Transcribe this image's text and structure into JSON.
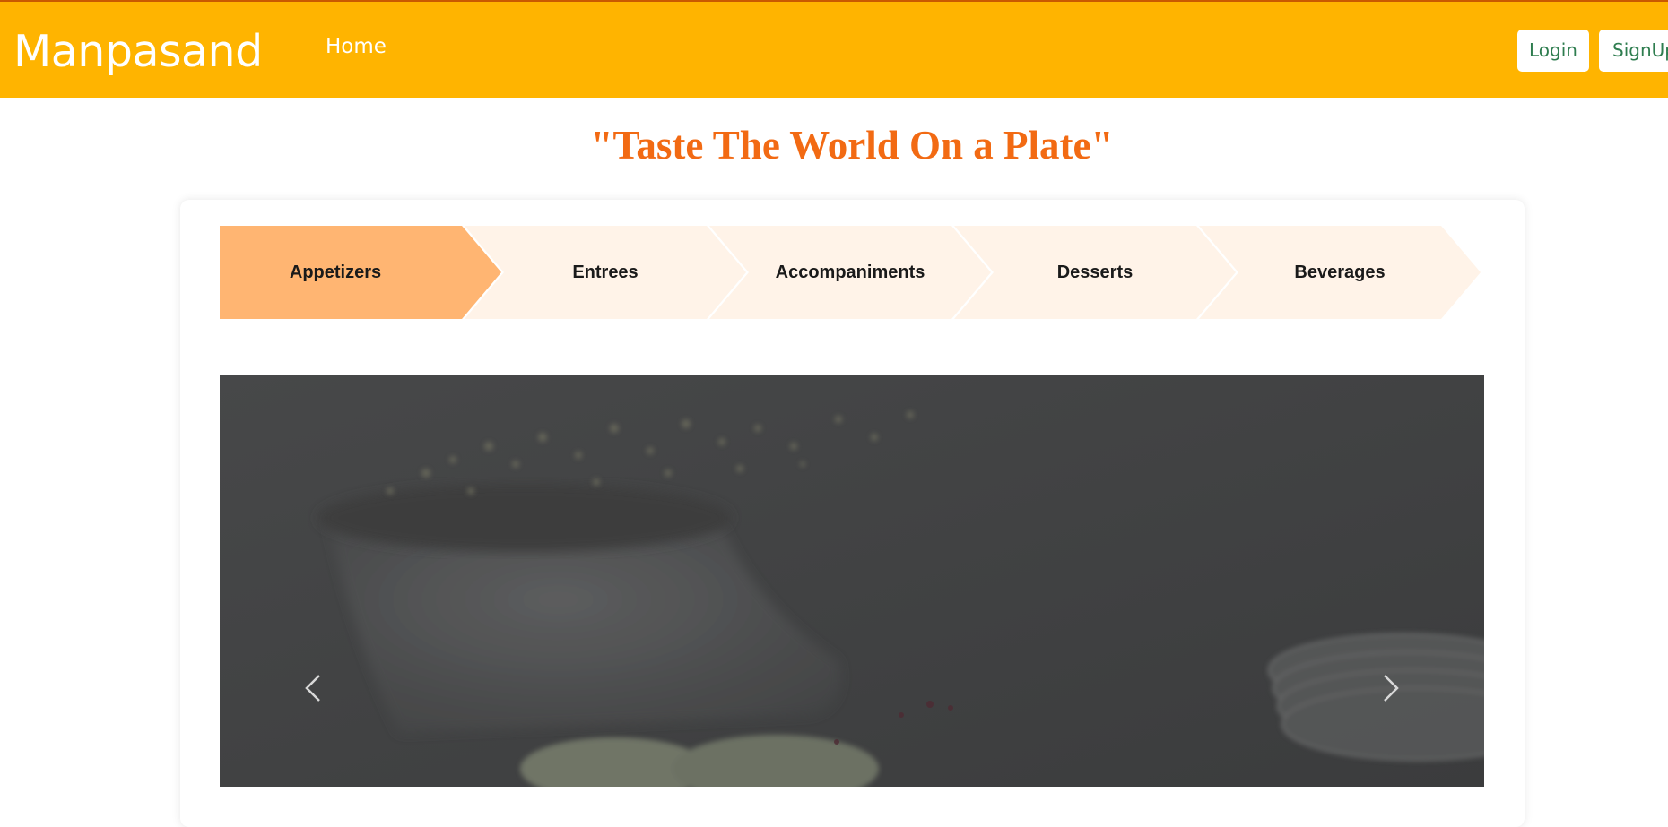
{
  "header": {
    "brand": "Manpasand",
    "nav": {
      "home_label": "Home"
    },
    "auth": {
      "login_label": "Login",
      "signup_label": "SignUp"
    }
  },
  "tagline": "\"Taste The World On a Plate\"",
  "steps": [
    {
      "label": "Appetizers",
      "active": true
    },
    {
      "label": "Entrees",
      "active": false
    },
    {
      "label": "Accompaniments",
      "active": false
    },
    {
      "label": "Desserts",
      "active": false
    },
    {
      "label": "Beverages",
      "active": false
    }
  ],
  "carousel": {
    "prev_icon": "chevron-left-icon",
    "next_icon": "chevron-right-icon"
  },
  "colors": {
    "navbar": "#ffb400",
    "tagline": "#f26a13",
    "step_active": "#ffb572",
    "step_inactive": "#fff3e8",
    "button_text": "#2e7d4f"
  }
}
